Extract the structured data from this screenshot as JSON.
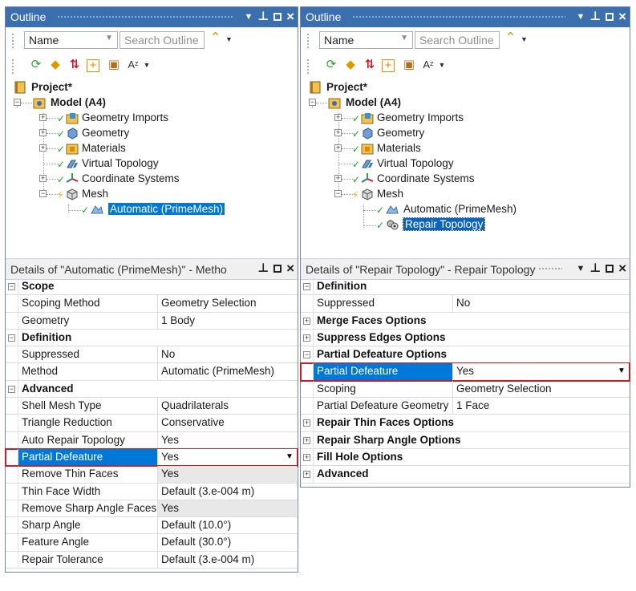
{
  "left": {
    "outline_title": "Outline",
    "name_combo": "Name",
    "search_placeholder": "Search Outline",
    "tree": {
      "project": "Project*",
      "model": "Model (A4)",
      "geometry_imports": "Geometry Imports",
      "geometry": "Geometry",
      "materials": "Materials",
      "virtual_topology": "Virtual Topology",
      "coordinate_systems": "Coordinate Systems",
      "mesh": "Mesh",
      "automatic": "Automatic (PrimeMesh)"
    },
    "details_title": "Details of \"Automatic (PrimeMesh)\" - Metho",
    "details": {
      "scope": "Scope",
      "scoping_method": "Scoping Method",
      "scoping_method_val": "Geometry Selection",
      "geometry": "Geometry",
      "geometry_val": "1 Body",
      "definition": "Definition",
      "suppressed": "Suppressed",
      "suppressed_val": "No",
      "method": "Method",
      "method_val": "Automatic (PrimeMesh)",
      "advanced": "Advanced",
      "shell_mesh_type": "Shell Mesh Type",
      "shell_mesh_type_val": "Quadrilaterals",
      "triangle_reduction": "Triangle Reduction",
      "triangle_reduction_val": "Conservative",
      "auto_repair": "Auto Repair Topology",
      "auto_repair_val": "Yes",
      "partial_defeature": "Partial Defeature",
      "partial_defeature_val": "Yes",
      "remove_thin_faces": "Remove Thin Faces",
      "remove_thin_faces_val": "Yes",
      "thin_face_width": "Thin Face Width",
      "thin_face_width_val": "Default (3.e-004 m)",
      "remove_sharp": "Remove Sharp Angle Faces",
      "remove_sharp_val": "Yes",
      "sharp_angle": "Sharp Angle",
      "sharp_angle_val": "Default (10.0°)",
      "feature_angle": "Feature Angle",
      "feature_angle_val": "Default (30.0°)",
      "repair_tol": "Repair Tolerance",
      "repair_tol_val": "Default (3.e-004 m)"
    }
  },
  "right": {
    "outline_title": "Outline",
    "name_combo": "Name",
    "search_placeholder": "Search Outline",
    "tree": {
      "project": "Project*",
      "model": "Model (A4)",
      "geometry_imports": "Geometry Imports",
      "geometry": "Geometry",
      "materials": "Materials",
      "virtual_topology": "Virtual Topology",
      "coordinate_systems": "Coordinate Systems",
      "mesh": "Mesh",
      "automatic": "Automatic (PrimeMesh)",
      "repair_topology": "Repair Topology"
    },
    "details_title": "Details of \"Repair Topology\" - Repair Topology",
    "details": {
      "definition": "Definition",
      "suppressed": "Suppressed",
      "suppressed_val": "No",
      "merge_faces": "Merge Faces Options",
      "suppress_edges": "Suppress Edges Options",
      "partial_defeature_options": "Partial Defeature Options",
      "partial_defeature": "Partial Defeature",
      "partial_defeature_val": "Yes",
      "scoping": "Scoping",
      "scoping_val": "Geometry Selection",
      "pd_geometry": "Partial Defeature Geometry",
      "pd_geometry_val": "1 Face",
      "repair_thin": "Repair Thin Faces Options",
      "repair_sharp": "Repair Sharp Angle Options",
      "fill_hole": "Fill Hole Options",
      "advanced": "Advanced"
    }
  },
  "colors": {
    "titlebar": "#3c6fad",
    "selection": "#0078d7",
    "highlight_border": "#c81e2a",
    "check": "#1aa51a"
  }
}
